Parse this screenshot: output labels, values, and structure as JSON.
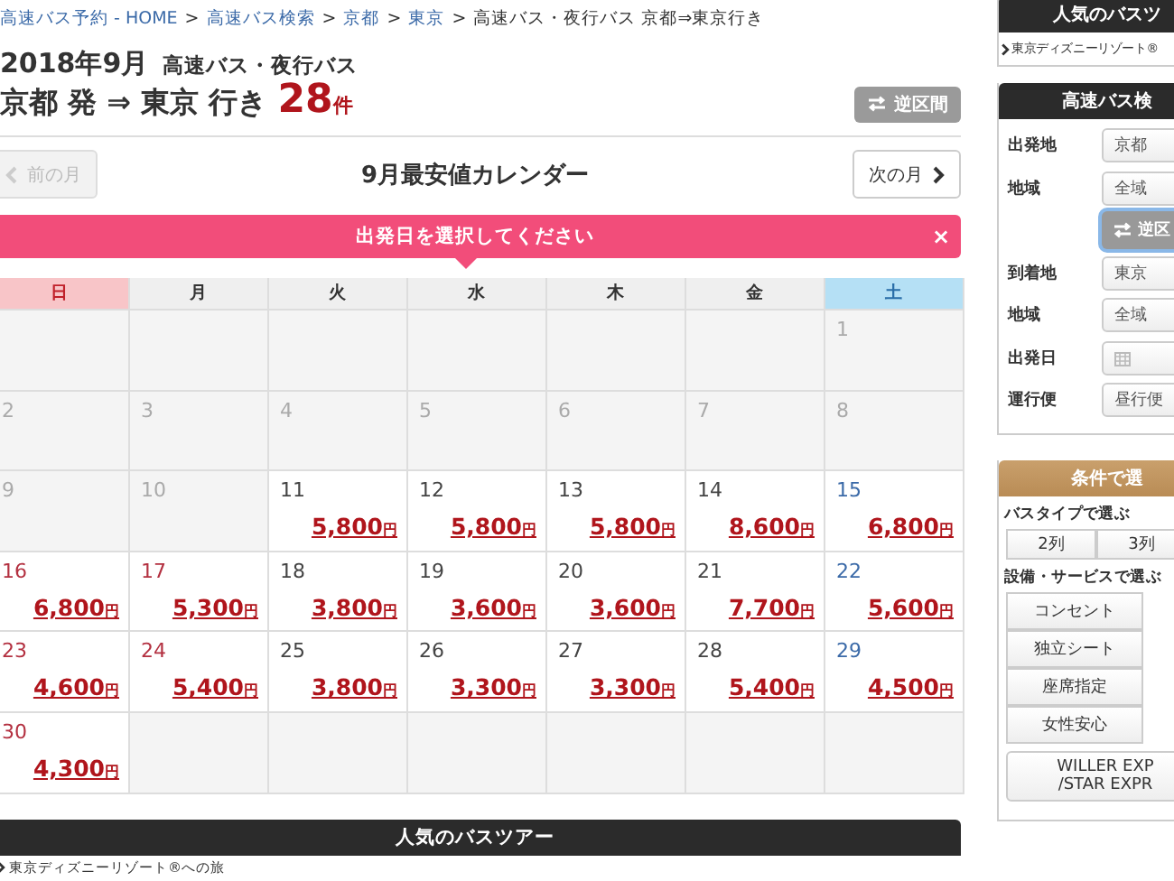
{
  "breadcrumb": [
    {
      "kind": "link",
      "text": "高速バス予約 - HOME"
    },
    {
      "kind": "sep",
      "text": ">"
    },
    {
      "kind": "link",
      "text": "高速バス検索"
    },
    {
      "kind": "sep",
      "text": ">"
    },
    {
      "kind": "link",
      "text": "京都"
    },
    {
      "kind": "sep",
      "text": ">"
    },
    {
      "kind": "link",
      "text": "東京"
    },
    {
      "kind": "sep",
      "text": ">"
    },
    {
      "kind": "current",
      "text": "高速バス・夜行バス 京都⇒東京行き"
    }
  ],
  "heading": {
    "month": "2018年9月",
    "category": "高速バス・夜行バス",
    "route": "京都 発 ⇒ 東京 行き",
    "count": "28",
    "count_unit": "件",
    "reverse_button": "逆区間"
  },
  "calendar": {
    "title": "9月最安値カレンダー",
    "prev": {
      "label": "前の月",
      "disabled": true
    },
    "next": {
      "label": "次の月",
      "disabled": false
    },
    "banner": {
      "text": "出発日を選択してください",
      "close": "×"
    },
    "weekdays": [
      {
        "label": "日",
        "kind": "sunday"
      },
      {
        "label": "月",
        "kind": "weekday"
      },
      {
        "label": "火",
        "kind": "weekday"
      },
      {
        "label": "水",
        "kind": "weekday"
      },
      {
        "label": "木",
        "kind": "weekday"
      },
      {
        "label": "金",
        "kind": "weekday"
      },
      {
        "label": "土",
        "kind": "saturday"
      }
    ],
    "weeks": [
      [
        {
          "kind": "empty"
        },
        {
          "kind": "empty"
        },
        {
          "kind": "empty"
        },
        {
          "kind": "empty"
        },
        {
          "kind": "empty"
        },
        {
          "kind": "empty"
        },
        {
          "kind": "saturday",
          "day": "1",
          "disabled": true
        }
      ],
      [
        {
          "kind": "sunday",
          "day": "2",
          "disabled": true
        },
        {
          "kind": "weekday",
          "day": "3",
          "disabled": true
        },
        {
          "kind": "weekday",
          "day": "4",
          "disabled": true
        },
        {
          "kind": "weekday",
          "day": "5",
          "disabled": true
        },
        {
          "kind": "weekday",
          "day": "6",
          "disabled": true
        },
        {
          "kind": "weekday",
          "day": "7",
          "disabled": true
        },
        {
          "kind": "saturday",
          "day": "8",
          "disabled": true
        }
      ],
      [
        {
          "kind": "sunday",
          "day": "9",
          "disabled": true
        },
        {
          "kind": "weekday",
          "day": "10",
          "disabled": true
        },
        {
          "kind": "weekday",
          "day": "11",
          "disabled": false,
          "price": "5,800",
          "unit": "円"
        },
        {
          "kind": "weekday",
          "day": "12",
          "disabled": false,
          "price": "5,800",
          "unit": "円"
        },
        {
          "kind": "weekday",
          "day": "13",
          "disabled": false,
          "price": "5,800",
          "unit": "円"
        },
        {
          "kind": "weekday",
          "day": "14",
          "disabled": false,
          "price": "8,600",
          "unit": "円"
        },
        {
          "kind": "saturday",
          "day": "15",
          "disabled": false,
          "price": "6,800",
          "unit": "円"
        }
      ],
      [
        {
          "kind": "sunday",
          "day": "16",
          "disabled": false,
          "price": "6,800",
          "unit": "円"
        },
        {
          "kind": "holiday",
          "day": "17",
          "disabled": false,
          "price": "5,300",
          "unit": "円"
        },
        {
          "kind": "weekday",
          "day": "18",
          "disabled": false,
          "price": "3,800",
          "unit": "円"
        },
        {
          "kind": "weekday",
          "day": "19",
          "disabled": false,
          "price": "3,600",
          "unit": "円"
        },
        {
          "kind": "weekday",
          "day": "20",
          "disabled": false,
          "price": "3,600",
          "unit": "円"
        },
        {
          "kind": "weekday",
          "day": "21",
          "disabled": false,
          "price": "7,700",
          "unit": "円"
        },
        {
          "kind": "saturday",
          "day": "22",
          "disabled": false,
          "price": "5,600",
          "unit": "円"
        }
      ],
      [
        {
          "kind": "sunday",
          "day": "23",
          "disabled": false,
          "price": "4,600",
          "unit": "円"
        },
        {
          "kind": "holiday",
          "day": "24",
          "disabled": false,
          "price": "5,400",
          "unit": "円"
        },
        {
          "kind": "weekday",
          "day": "25",
          "disabled": false,
          "price": "3,800",
          "unit": "円"
        },
        {
          "kind": "weekday",
          "day": "26",
          "disabled": false,
          "price": "3,300",
          "unit": "円"
        },
        {
          "kind": "weekday",
          "day": "27",
          "disabled": false,
          "price": "3,300",
          "unit": "円"
        },
        {
          "kind": "weekday",
          "day": "28",
          "disabled": false,
          "price": "5,400",
          "unit": "円"
        },
        {
          "kind": "saturday",
          "day": "29",
          "disabled": false,
          "price": "4,500",
          "unit": "円"
        }
      ],
      [
        {
          "kind": "sunday",
          "day": "30",
          "disabled": false,
          "price": "4,300",
          "unit": "円"
        },
        {
          "kind": "empty"
        },
        {
          "kind": "empty"
        },
        {
          "kind": "empty"
        },
        {
          "kind": "empty"
        },
        {
          "kind": "empty"
        },
        {
          "kind": "empty"
        }
      ]
    ]
  },
  "tours": {
    "title": "人気のバスツアー",
    "link": "東京ディズニーリゾート®への旅"
  },
  "sidebar": {
    "popular": {
      "title": "人気のバスツ",
      "link": "東京ディズニーリゾート®"
    },
    "search": {
      "title": "高速バス検",
      "rows": [
        {
          "kind": "select",
          "label": "出発地",
          "value": "京都"
        },
        {
          "kind": "select",
          "label": "地域",
          "value": "全域"
        },
        {
          "kind": "button",
          "value": "逆区",
          "focused": true
        },
        {
          "kind": "select",
          "label": "到着地",
          "value": "東京"
        },
        {
          "kind": "select",
          "label": "地域",
          "value": "全域"
        },
        {
          "kind": "date",
          "label": "出発日"
        },
        {
          "kind": "select",
          "label": "運行便",
          "value": "昼行便"
        }
      ]
    },
    "conditions": {
      "title": "条件で選",
      "bus_type_label": "バスタイプで選ぶ",
      "bus_types": [
        "2列",
        "3列"
      ],
      "facility_label": "設備・サービスで選ぶ",
      "facilities": [
        "コンセント",
        "独立シート",
        "座席指定",
        "女性安心"
      ],
      "operator_lines": [
        "WILLER EXP",
        "/STAR EXPR"
      ]
    }
  }
}
